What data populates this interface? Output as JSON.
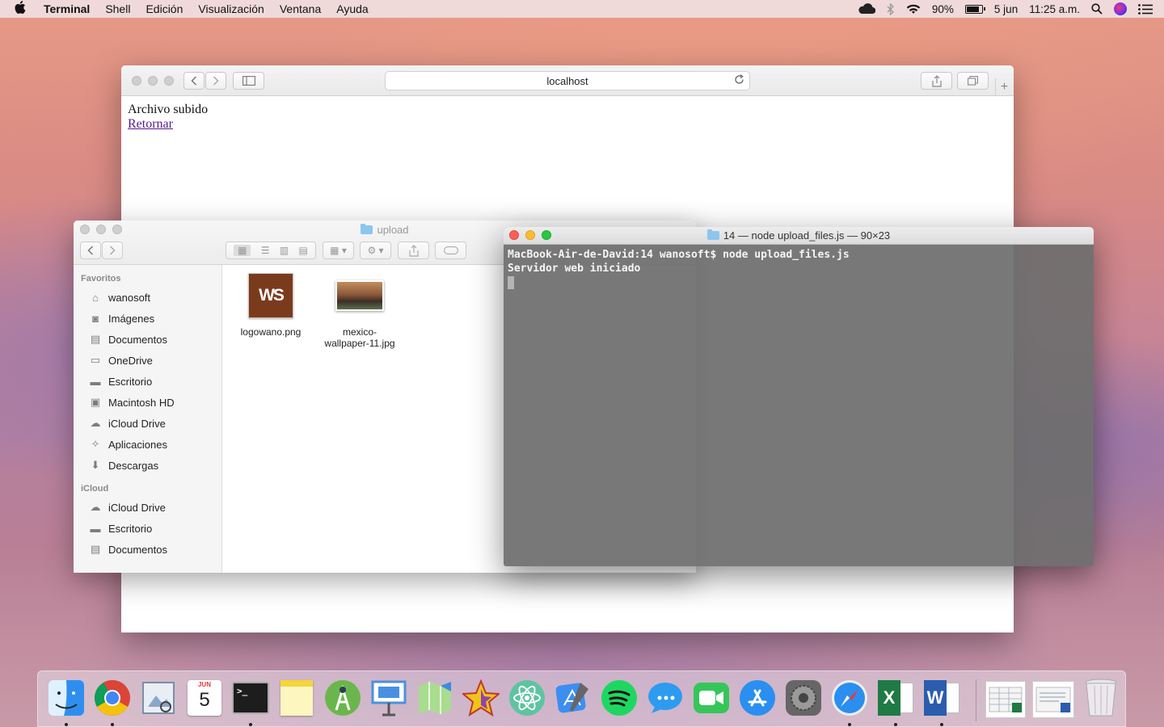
{
  "menubar": {
    "app_name": "Terminal",
    "menus": [
      "Shell",
      "Edición",
      "Visualización",
      "Ventana",
      "Ayuda"
    ],
    "battery_percent": "90%",
    "battery_level": 0.9,
    "date": "5 jun",
    "time": "11:25 a.m."
  },
  "browser": {
    "address": "localhost",
    "heading_text": "Archivo subido",
    "link_text": "Retornar"
  },
  "finder": {
    "title": "upload",
    "sections": [
      {
        "label": "Favoritos",
        "items": [
          {
            "label": "wanosoft",
            "icon": "house-icon"
          },
          {
            "label": "Imágenes",
            "icon": "camera-icon"
          },
          {
            "label": "Documentos",
            "icon": "document-icon"
          },
          {
            "label": "OneDrive",
            "icon": "folder-icon"
          },
          {
            "label": "Escritorio",
            "icon": "desktop-icon"
          },
          {
            "label": "Macintosh HD",
            "icon": "hard-drive-icon"
          },
          {
            "label": "iCloud Drive",
            "icon": "cloud-icon"
          },
          {
            "label": "Aplicaciones",
            "icon": "apps-icon"
          },
          {
            "label": "Descargas",
            "icon": "download-icon"
          }
        ]
      },
      {
        "label": "iCloud",
        "items": [
          {
            "label": "iCloud Drive",
            "icon": "cloud-icon"
          },
          {
            "label": "Escritorio",
            "icon": "desktop-icon"
          },
          {
            "label": "Documentos",
            "icon": "document-icon"
          }
        ]
      }
    ],
    "files": [
      {
        "name": "logowano.png",
        "thumb_text": "WS"
      },
      {
        "name_line1": "mexico-",
        "name_line2": "wallpaper-11.jpg"
      }
    ]
  },
  "terminal": {
    "title": "14 — node upload_files.js — 90×23",
    "lines": [
      "MacBook-Air-de-David:14 wanosoft$ node upload_files.js",
      "Servidor web iniciado"
    ]
  },
  "dock": {
    "apps": [
      {
        "name": "Finder",
        "icon": "finder-icon",
        "color": "#3a8ee6",
        "running": true
      },
      {
        "name": "Google Chrome",
        "icon": "chrome-icon",
        "color": "#db4437",
        "running": true
      },
      {
        "name": "Preview",
        "icon": "preview-icon",
        "color": "#8aa6c8",
        "running": false
      },
      {
        "name": "Calendar",
        "icon": "calendar-icon",
        "color": "#ffffff",
        "running": false,
        "month": "JUN",
        "day": "5"
      },
      {
        "name": "Terminal",
        "icon": "terminal-icon",
        "color": "#222222",
        "running": true
      },
      {
        "name": "Notes",
        "icon": "notes-icon",
        "color": "#fbe26a",
        "running": false
      },
      {
        "name": "Android Studio",
        "icon": "android-studio-icon",
        "color": "#6bb64c",
        "running": false
      },
      {
        "name": "Keynote",
        "icon": "keynote-icon",
        "color": "#4a90e2",
        "running": false
      },
      {
        "name": "Maps",
        "icon": "maps-icon",
        "color": "#73c06a",
        "running": false
      },
      {
        "name": "Starlight",
        "icon": "star-icon",
        "color": "#e0402d",
        "running": false
      },
      {
        "name": "Atom",
        "icon": "atom-icon",
        "color": "#5fc3a0",
        "running": false
      },
      {
        "name": "Xcode",
        "icon": "xcode-icon",
        "color": "#3c8ef0",
        "running": false
      },
      {
        "name": "Spotify",
        "icon": "spotify-icon",
        "color": "#1ed760",
        "running": false
      },
      {
        "name": "Messages",
        "icon": "messages-icon",
        "color": "#2d9bf0",
        "running": false
      },
      {
        "name": "FaceTime",
        "icon": "facetime-icon",
        "color": "#35c659",
        "running": false
      },
      {
        "name": "App Store",
        "icon": "app-store-icon",
        "color": "#2a8ff0",
        "running": false
      },
      {
        "name": "System Preferences",
        "icon": "system-preferences-icon",
        "color": "#7d7d7d",
        "running": false
      },
      {
        "name": "Safari",
        "icon": "safari-icon",
        "color": "#2a8ff0",
        "running": true
      },
      {
        "name": "Excel",
        "icon": "excel-icon",
        "color": "#1f7a44",
        "running": true
      },
      {
        "name": "Word",
        "icon": "word-icon",
        "color": "#2b5cae",
        "running": true
      }
    ],
    "recent_docs": [
      {
        "name": "Excel document",
        "icon": "excel-document-icon"
      },
      {
        "name": "Word document",
        "icon": "word-document-icon"
      }
    ],
    "trash": {
      "name": "Trash",
      "icon": "trash-icon"
    }
  }
}
